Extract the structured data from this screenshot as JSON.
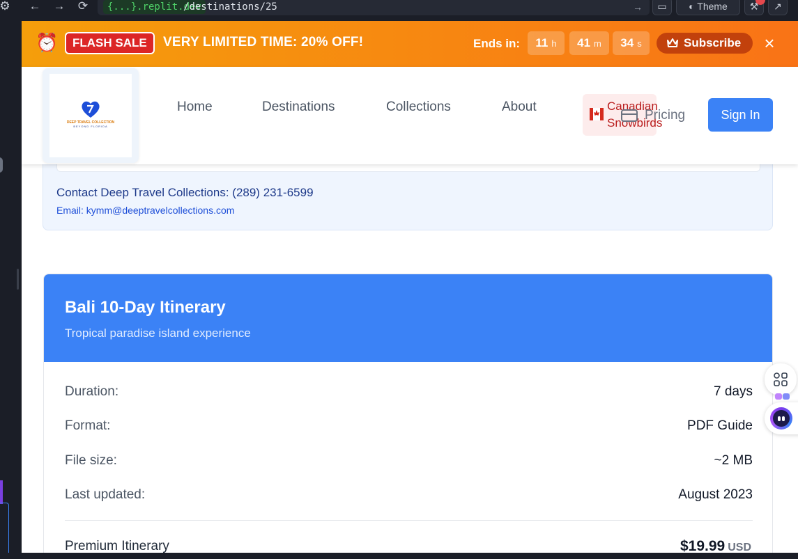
{
  "browser": {
    "url_host": "{...}.replit.dev",
    "url_path": "/destinations/25",
    "theme_label": "Theme"
  },
  "flash_banner": {
    "badge": "FLASH SALE",
    "headline": "VERY LIMITED TIME:  20% OFF!",
    "ends_label": "Ends in:",
    "hours": "11",
    "hours_unit": "h",
    "minutes": "41",
    "minutes_unit": "m",
    "seconds": "34",
    "seconds_unit": "s",
    "subscribe_label": "Subscribe",
    "close_label": "×"
  },
  "header": {
    "logo_line1": "DEEP TRAVEL COLLECTION",
    "logo_line2": "BEYOND FLORIDA",
    "nav": {
      "home": "Home",
      "destinations": "Destinations",
      "collections": "Collections",
      "about": "About",
      "snowbirds_line1": "Canadian",
      "snowbirds_line2": "Snowbirds",
      "pricing": "Pricing"
    },
    "signin_label": "Sign In"
  },
  "contact": {
    "phone_line": "Contact Deep Travel Collections: (289) 231-6599",
    "email_line": "Email: kymm@deeptravelcollections.com"
  },
  "itinerary": {
    "title": "Bali 10-Day Itinerary",
    "subtitle": "Tropical paradise island experience",
    "details": [
      {
        "label": "Duration:",
        "value": "7 days"
      },
      {
        "label": "Format:",
        "value": "PDF Guide"
      },
      {
        "label": "File size:",
        "value": "~2 MB"
      },
      {
        "label": "Last updated:",
        "value": "August 2023"
      }
    ],
    "premium_label": "Premium Itinerary",
    "price": "$19.99",
    "currency": "USD"
  },
  "colors": {
    "accent": "#3b82f6",
    "flash_start": "#f59e0b",
    "flash_end": "#f97316",
    "sale_badge": "#dc2626"
  }
}
